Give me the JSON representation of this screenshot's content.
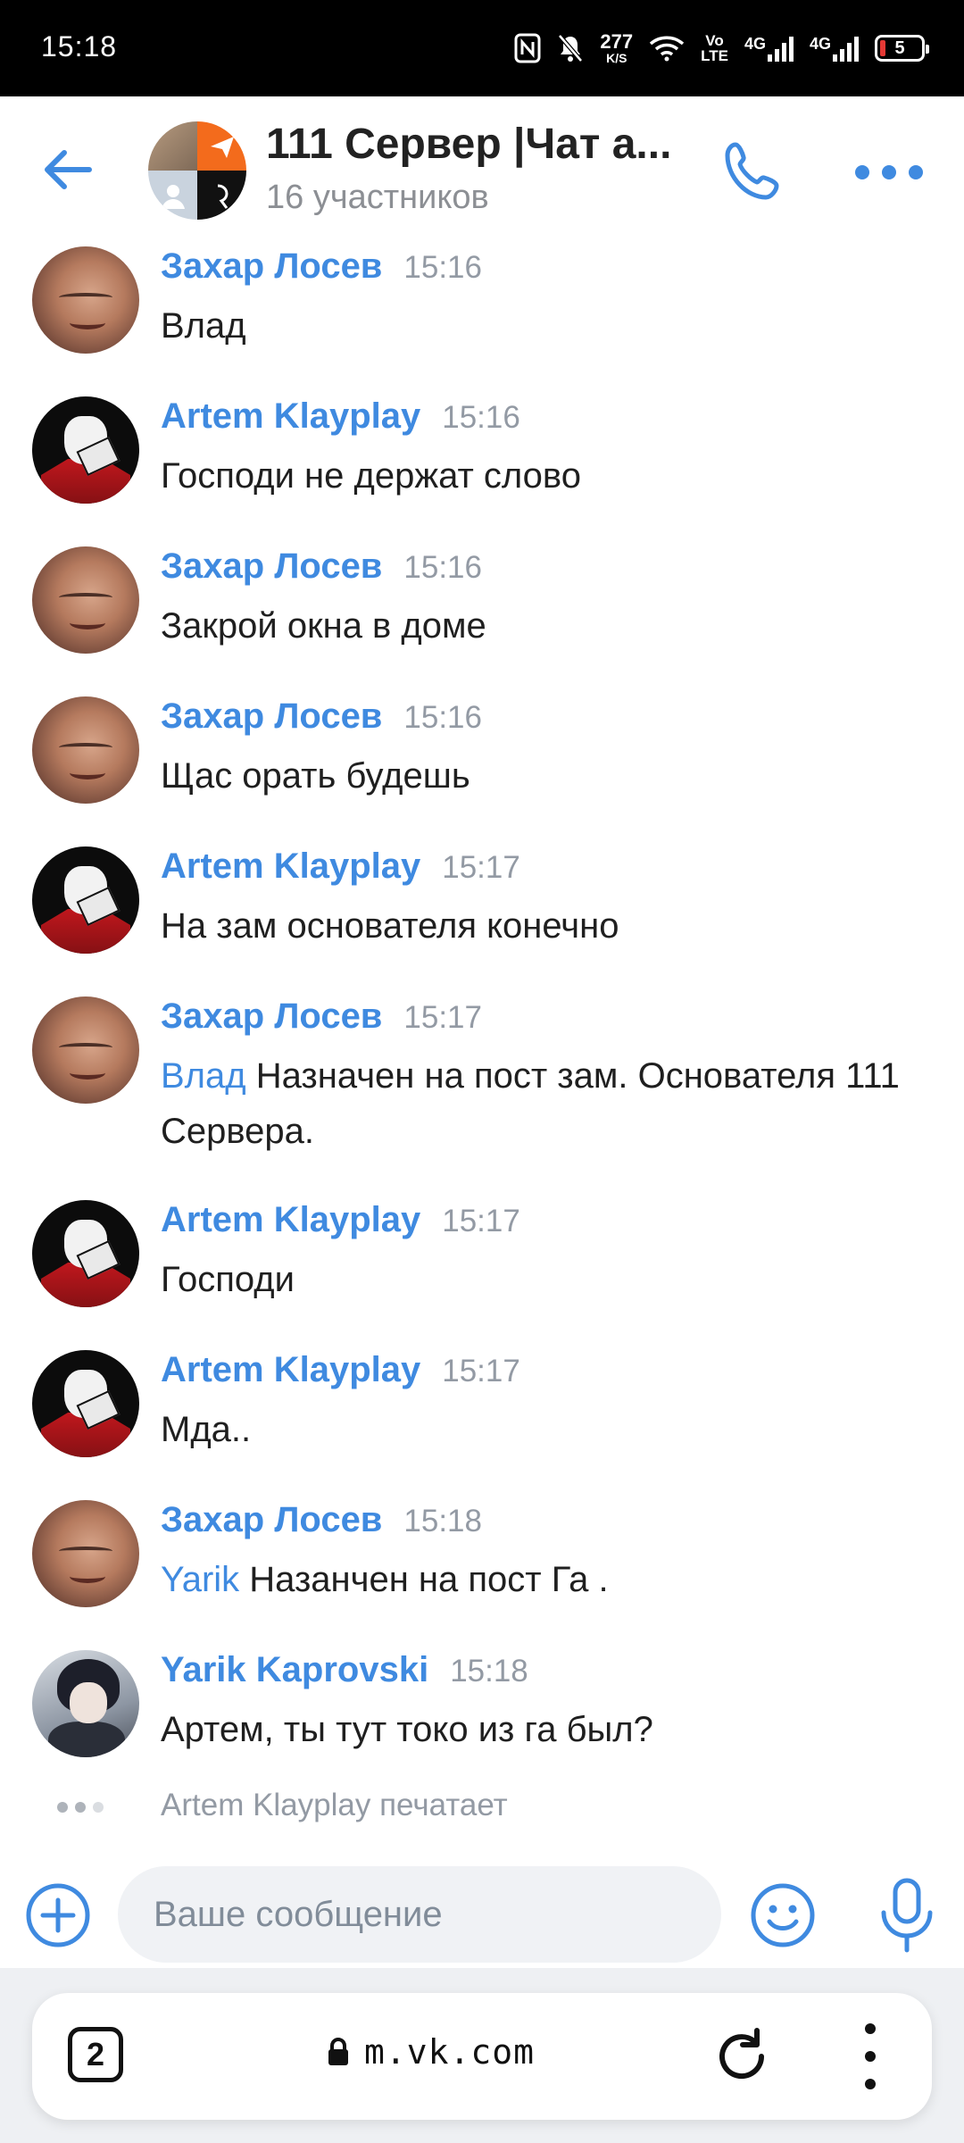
{
  "status_bar": {
    "time": "15:18",
    "net_speed": "277",
    "net_speed_unit": "K/S",
    "volte_top": "Vo",
    "volte_bottom": "LTE",
    "net1": "4G",
    "net2": "4G",
    "battery": "5"
  },
  "header": {
    "title": "111 Сервер |Чат а...",
    "subtitle": "16 участников"
  },
  "messages": [
    {
      "author": "Захар Лосев",
      "time": "15:16",
      "text": "Влад",
      "avatar": "zakhar"
    },
    {
      "author": "Artem Klayplay",
      "time": "15:16",
      "text": "Господи не держат слово",
      "avatar": "artem"
    },
    {
      "author": "Захар Лосев",
      "time": "15:16",
      "text": "Закрой окна в доме",
      "avatar": "zakhar"
    },
    {
      "author": "Захар Лосев",
      "time": "15:16",
      "text": "Щас орать будешь",
      "avatar": "zakhar"
    },
    {
      "author": "Artem Klayplay",
      "time": "15:17",
      "text": "На зам основателя конечно",
      "avatar": "artem"
    },
    {
      "author": "Захар Лосев",
      "time": "15:17",
      "mention": "Влад",
      "text": " Назначен на пост зам. Основателя 111 Сервера.",
      "avatar": "zakhar"
    },
    {
      "author": "Artem Klayplay",
      "time": "15:17",
      "text": "Господи",
      "avatar": "artem"
    },
    {
      "author": "Artem Klayplay",
      "time": "15:17",
      "text": "Мда..",
      "avatar": "artem"
    },
    {
      "author": "Захар Лосев",
      "time": "15:18",
      "mention": "Yarik",
      "text": " Назанчен на пост Га .",
      "avatar": "zakhar"
    },
    {
      "author": "Yarik Kaprovski",
      "time": "15:18",
      "text": "Артем, ты тут токо из га был?",
      "avatar": "yarik"
    }
  ],
  "typing": "Artem Klayplay печатает",
  "composer": {
    "placeholder": "Ваше сообщение"
  },
  "browser": {
    "tabs_count": "2",
    "url": "m.vk.com"
  },
  "colors": {
    "accent": "#3f8ae0",
    "text": "#1f1f1f",
    "muted": "#939aa4"
  }
}
